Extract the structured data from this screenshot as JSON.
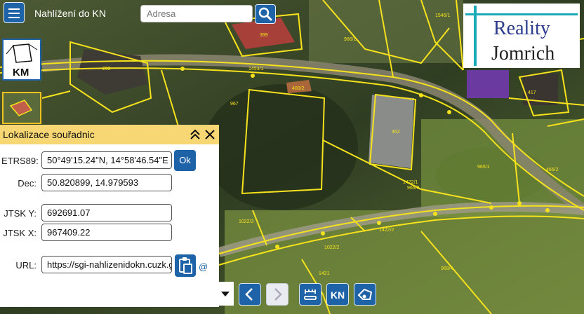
{
  "app": {
    "title": "Nahlížení do KN",
    "search_placeholder": "Adresa"
  },
  "logo": {
    "line1": "Reality",
    "line2": "Jomrich"
  },
  "layers": {
    "km_label": "KM"
  },
  "map_labels": [
    "399",
    "1546/1",
    "966/1",
    "292",
    "1453/1",
    "400/2",
    "462",
    "967",
    "417",
    "1022/3",
    "1022/2",
    "1422/2",
    "1421",
    "968/4",
    "965/1",
    "966/3",
    "466/2",
    "1422/1"
  ],
  "panel": {
    "title": "Lokalizace souřadnic",
    "etrs_label": "ETRS89:",
    "etrs_value": "50°49'15.24\"N, 14°58'46.54\"E",
    "ok_label": "Ok",
    "dec_label": "Dec:",
    "dec_value": "50.820899, 14.979593",
    "jtsk_y_label": "JTSK Y:",
    "jtsk_y_value": "692691.07",
    "jtsk_x_label": "JTSK X:",
    "jtsk_x_value": "967409.22",
    "url_label": "URL:",
    "url_value": "https://sgi-nahlizenidokn.cuzk.gov.cz",
    "at_label": "@"
  },
  "toolbar": {
    "kn_label": "KN"
  },
  "colors": {
    "accent": "#1e63a8",
    "parcel_line": "#f5e21c",
    "panel_header": "#f7d774",
    "logo_stripe": "#1aa9b8"
  }
}
